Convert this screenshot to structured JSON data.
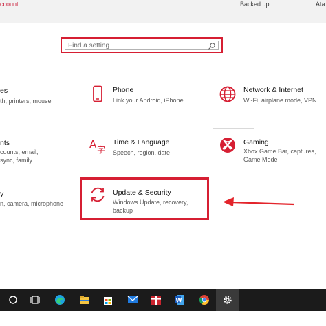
{
  "topbar": {
    "account_text": "ccount",
    "backed_up": "Backed up",
    "att": "Ata"
  },
  "search": {
    "placeholder": "Find a setting"
  },
  "tiles": {
    "system": {
      "title": "es",
      "desc": "th, printers, mouse"
    },
    "phone": {
      "title": "Phone",
      "desc": "Link your Android, iPhone"
    },
    "network": {
      "title": "Network & Internet",
      "desc": "Wi-Fi, airplane mode, VPN"
    },
    "accounts": {
      "title": "nts",
      "desc": "counts, email, sync, family"
    },
    "time": {
      "title": "Time & Language",
      "desc": "Speech, region, date"
    },
    "gaming": {
      "title": "Gaming",
      "desc": "Xbox Game Bar, captures, Game Mode"
    },
    "privacy": {
      "title": "y",
      "desc": "n, camera, microphone"
    },
    "update": {
      "title": "Update & Security",
      "desc": "Windows Update, recovery, backup"
    }
  },
  "colors": {
    "accent": "#d61f33",
    "arrow": "#e3242b",
    "taskbar": "#1b1b1b"
  },
  "taskbar": {
    "icons": [
      "search-icon",
      "task-view-icon",
      "edge-icon",
      "file-explorer-icon",
      "store-icon",
      "mail-icon",
      "gift-icon",
      "word-icon",
      "chrome-icon",
      "settings-icon"
    ]
  }
}
